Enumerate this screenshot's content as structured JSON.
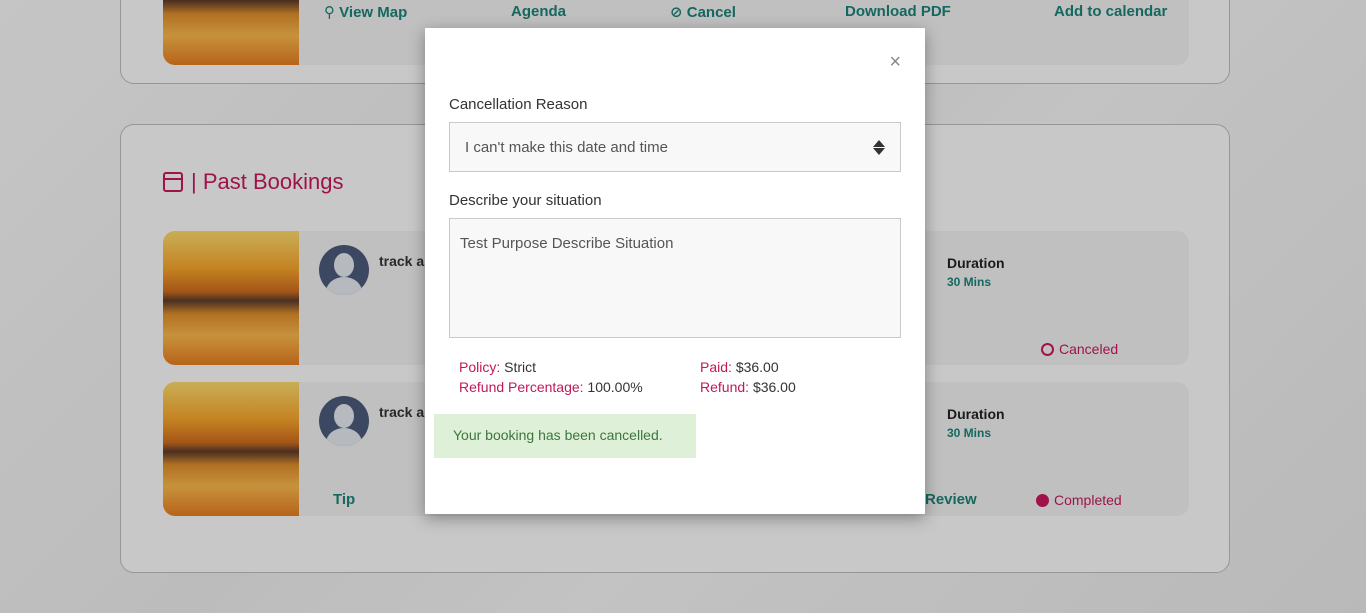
{
  "upcoming": {
    "actions": {
      "view_map": "View Map",
      "agenda": "Agenda",
      "cancel": "Cancel",
      "download_pdf": "Download PDF",
      "add_to_calendar": "Add to calendar"
    }
  },
  "past": {
    "title": "| Past Bookings",
    "rows": [
      {
        "name": "track a",
        "duration_label": "Duration",
        "duration_value": "30 Mins",
        "status": "Canceled"
      },
      {
        "name": "track a",
        "duration_label": "Duration",
        "duration_value": "30 Mins",
        "status": "Completed",
        "tip": "Tip",
        "review": "Review"
      }
    ]
  },
  "modal": {
    "close": "×",
    "reason_label": "Cancellation Reason",
    "reason_value": "I can't make this date and time",
    "describe_label": "Describe your situation",
    "describe_value": "Test Purpose Describe Situation",
    "policy_key": "Policy:",
    "policy_value": "Strict",
    "refund_pct_key": "Refund Percentage:",
    "refund_pct_value": "100.00%",
    "paid_key": "Paid:",
    "paid_value": "$36.00",
    "refund_key": "Refund:",
    "refund_value": "$36.00",
    "success_message": "Your booking has been cancelled."
  },
  "colors": {
    "brand_pink": "#c2185b",
    "brand_teal": "#1a7f74",
    "success_bg": "#dff0d8"
  }
}
